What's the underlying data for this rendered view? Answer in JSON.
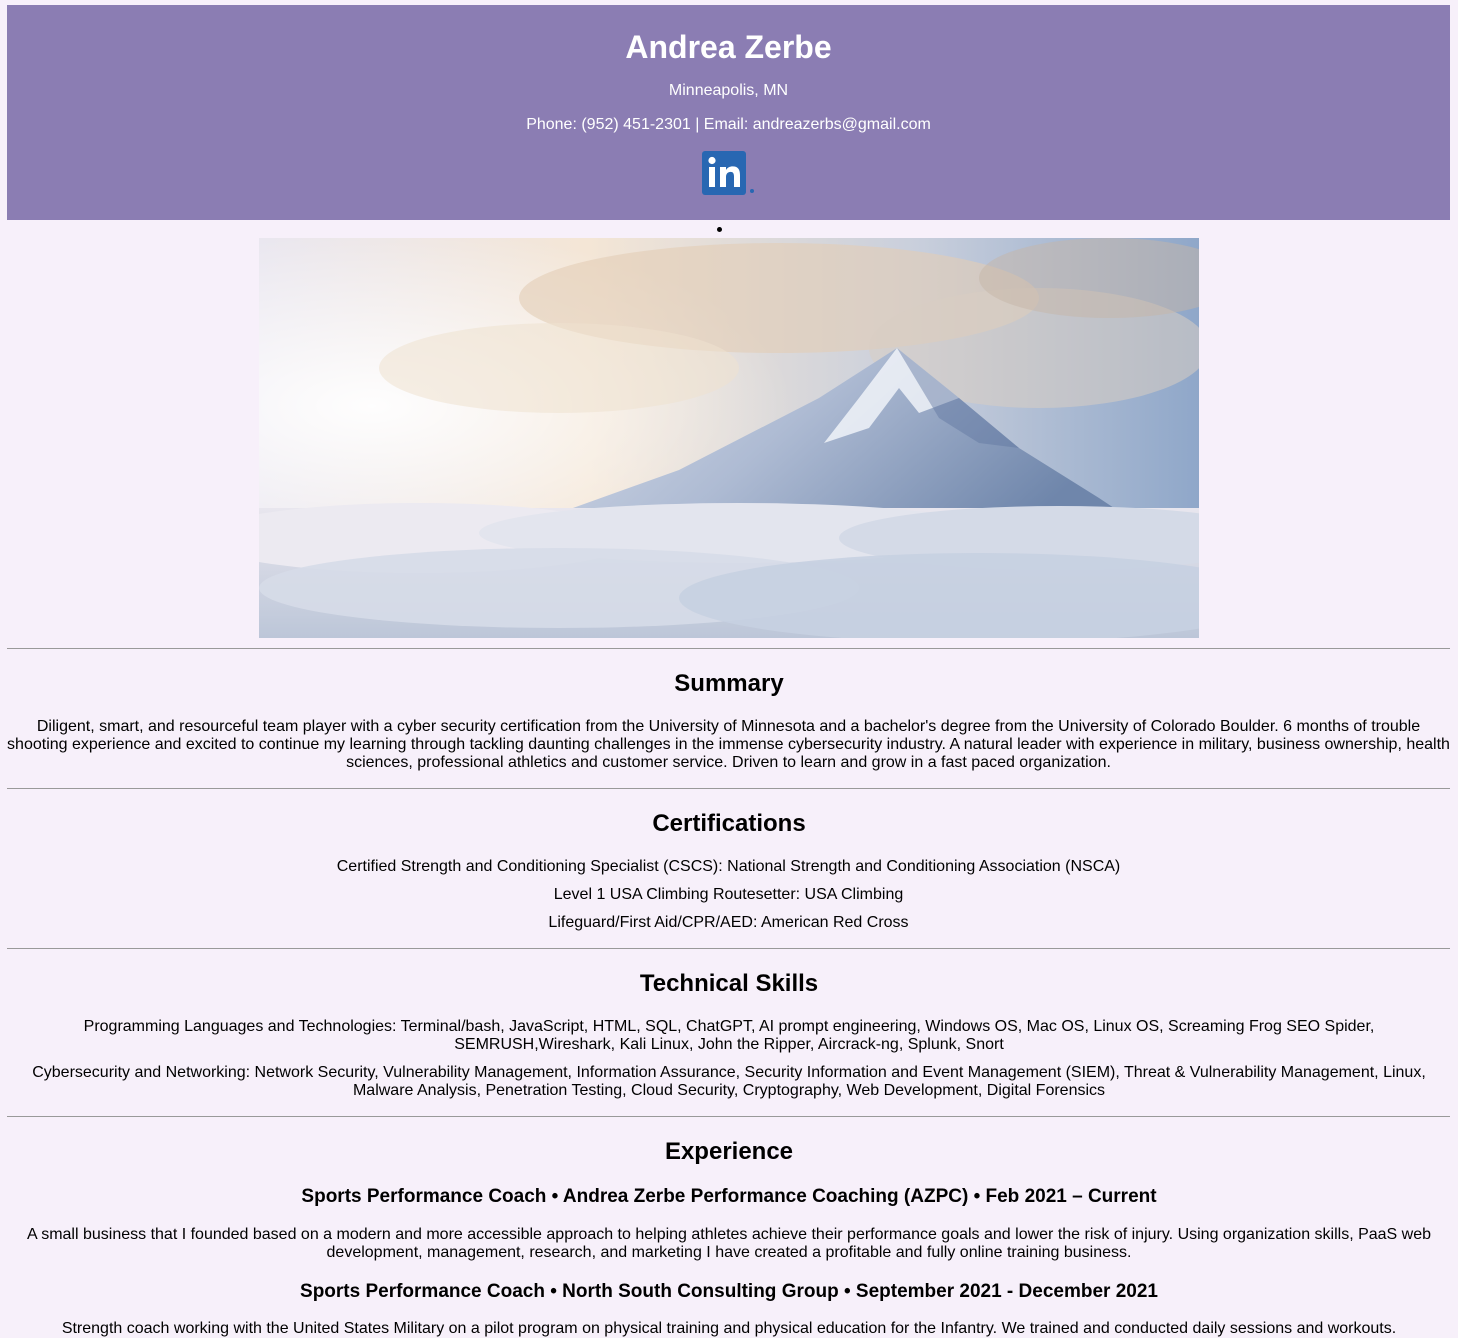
{
  "header": {
    "name": "Andrea Zerbe",
    "location": "Minneapolis, MN",
    "contact": "Phone: (952) 451-2301 | Email: andreazerbs@gmail.com",
    "linkedin_icon": "linkedin-icon",
    "linkedin_text": "in"
  },
  "colors": {
    "header_bg": "#8b7db3",
    "page_bg": "#f7f0fa",
    "linkedin_blue": "#2867b2"
  },
  "summary": {
    "title": "Summary",
    "text": "Diligent, smart, and resourceful team player with a cyber security certification from the University of Minnesota and a bachelor's degree from the University of Colorado Boulder. 6 months of trouble shooting experience and excited to continue my learning through tackling daunting challenges in the immense cybersecurity industry. A natural leader with experience in military, business ownership, health sciences, professional athletics and customer service. Driven to learn and grow in a fast paced organization."
  },
  "certifications": {
    "title": "Certifications",
    "items": [
      "Certified Strength and Conditioning Specialist (CSCS): National Strength and Conditioning Association (NSCA)",
      "Level 1 USA Climbing Routesetter: USA Climbing",
      "Lifeguard/First Aid/CPR/AED: American Red Cross"
    ]
  },
  "skills": {
    "title": "Technical Skills",
    "items": [
      "Programming Languages and Technologies: Terminal/bash, JavaScript, HTML, SQL, ChatGPT, AI prompt engineering, Windows OS, Mac OS, Linux OS, Screaming Frog SEO Spider, SEMRUSH,Wireshark, Kali Linux, John the Ripper, Aircrack-ng, Splunk, Snort",
      "Cybersecurity and Networking: Network Security, Vulnerability Management, Information Assurance, Security Information and Event Management (SIEM), Threat & Vulnerability Management, Linux, Malware Analysis, Penetration Testing, Cloud Security, Cryptography, Web Development, Digital Forensics"
    ]
  },
  "experience": {
    "title": "Experience",
    "jobs": [
      {
        "heading": "Sports Performance Coach • Andrea Zerbe Performance Coaching (AZPC) • Feb 2021 – Current",
        "description": "A small business that I founded based on a modern and more accessible approach to helping athletes achieve their performance goals and lower the risk of injury. Using organization skills, PaaS web development, management, research, and marketing I have created a profitable and fully online training business."
      },
      {
        "heading": "Sports Performance Coach • North South Consulting Group • September 2021 - December 2021",
        "description": "Strength coach working with the United States Military on a pilot program on physical training and physical education for the Infantry. We trained and conducted daily sessions and workouts."
      }
    ]
  }
}
